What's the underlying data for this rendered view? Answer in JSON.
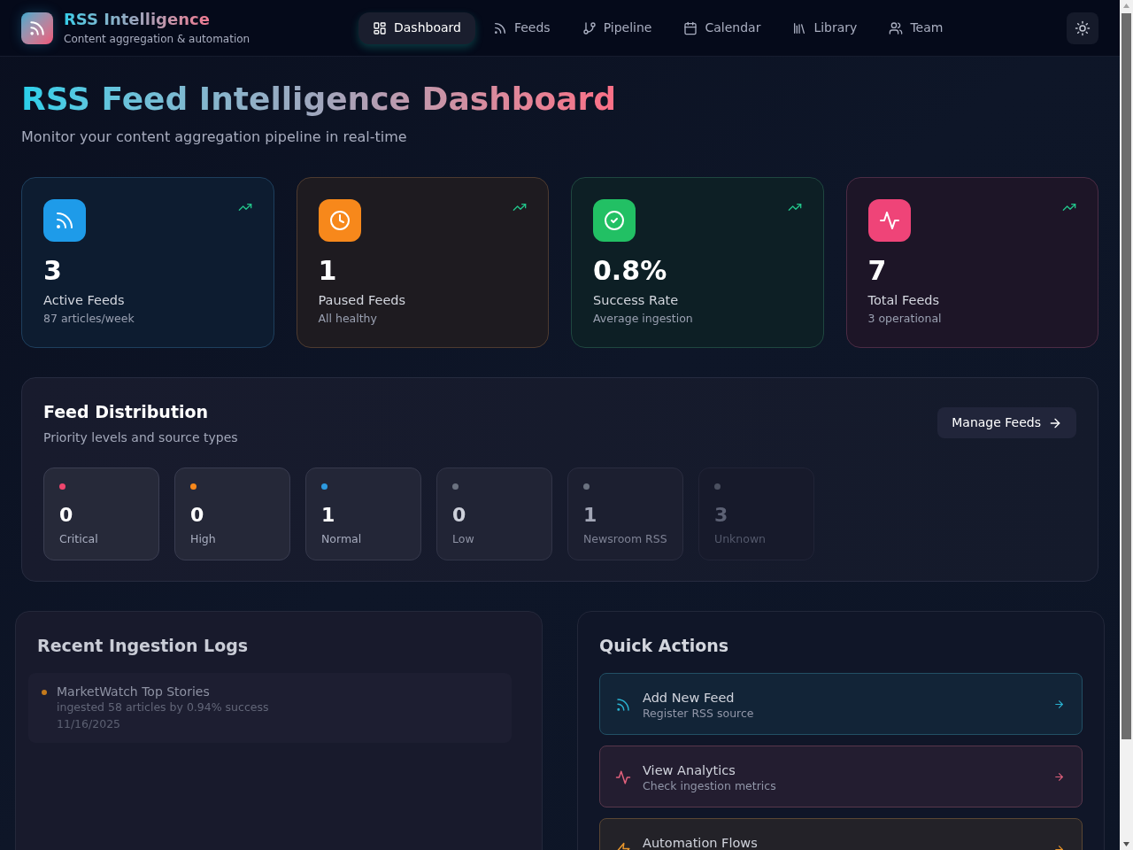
{
  "header": {
    "app_title": "RSS Intelligence",
    "app_subtitle": "Content aggregation & automation",
    "nav": [
      {
        "label": "Dashboard",
        "selected": true
      },
      {
        "label": "Feeds",
        "selected": false
      },
      {
        "label": "Pipeline",
        "selected": false
      },
      {
        "label": "Calendar",
        "selected": false
      },
      {
        "label": "Library",
        "selected": false
      },
      {
        "label": "Team",
        "selected": false
      }
    ]
  },
  "page": {
    "title": "RSS Feed Intelligence Dashboard",
    "subtitle": "Monitor your content aggregation pipeline in real-time"
  },
  "stat_cards": [
    {
      "value": "3",
      "label": "Active Feeds",
      "detail": "87 articles/week",
      "color": "#1e9be9"
    },
    {
      "value": "1",
      "label": "Paused Feeds",
      "detail": "All healthy",
      "color": "#f7881b"
    },
    {
      "value": "0.8%",
      "label": "Success Rate",
      "detail": "Average ingestion",
      "color": "#22c064"
    },
    {
      "value": "7",
      "label": "Total Feeds",
      "detail": "3 operational",
      "color": "#ef4478"
    }
  ],
  "feed_distribution": {
    "title": "Feed Distribution",
    "subtitle": "Priority levels and source types",
    "button": "Manage Feeds",
    "tiles": [
      {
        "value": "0",
        "label": "Critical",
        "color": "#f0466e"
      },
      {
        "value": "0",
        "label": "High",
        "color": "#f7881b"
      },
      {
        "value": "1",
        "label": "Normal",
        "color": "#2d9ae0"
      },
      {
        "value": "0",
        "label": "Low",
        "color": "#6b7280"
      },
      {
        "value": "1",
        "label": "Newsroom RSS",
        "color": "#6b7280"
      },
      {
        "value": "3",
        "label": "Unknown",
        "color": "#4b5060"
      }
    ]
  },
  "recent_logs": {
    "title": "Recent Ingestion Logs",
    "entries": [
      {
        "feed": "MarketWatch Top Stories",
        "detail": "ingested 58 articles by 0.94% success",
        "date": "11/16/2025",
        "color": "#c47a1c"
      }
    ]
  },
  "quick_actions": {
    "title": "Quick Actions",
    "actions": [
      {
        "title": "Add New Feed",
        "subtitle": "Register RSS source",
        "color": "#2ab3d2"
      },
      {
        "title": "View Analytics",
        "subtitle": "Check ingestion metrics",
        "color": "#e0607c"
      },
      {
        "title": "Automation Flows",
        "color": "#e8962c"
      }
    ]
  }
}
